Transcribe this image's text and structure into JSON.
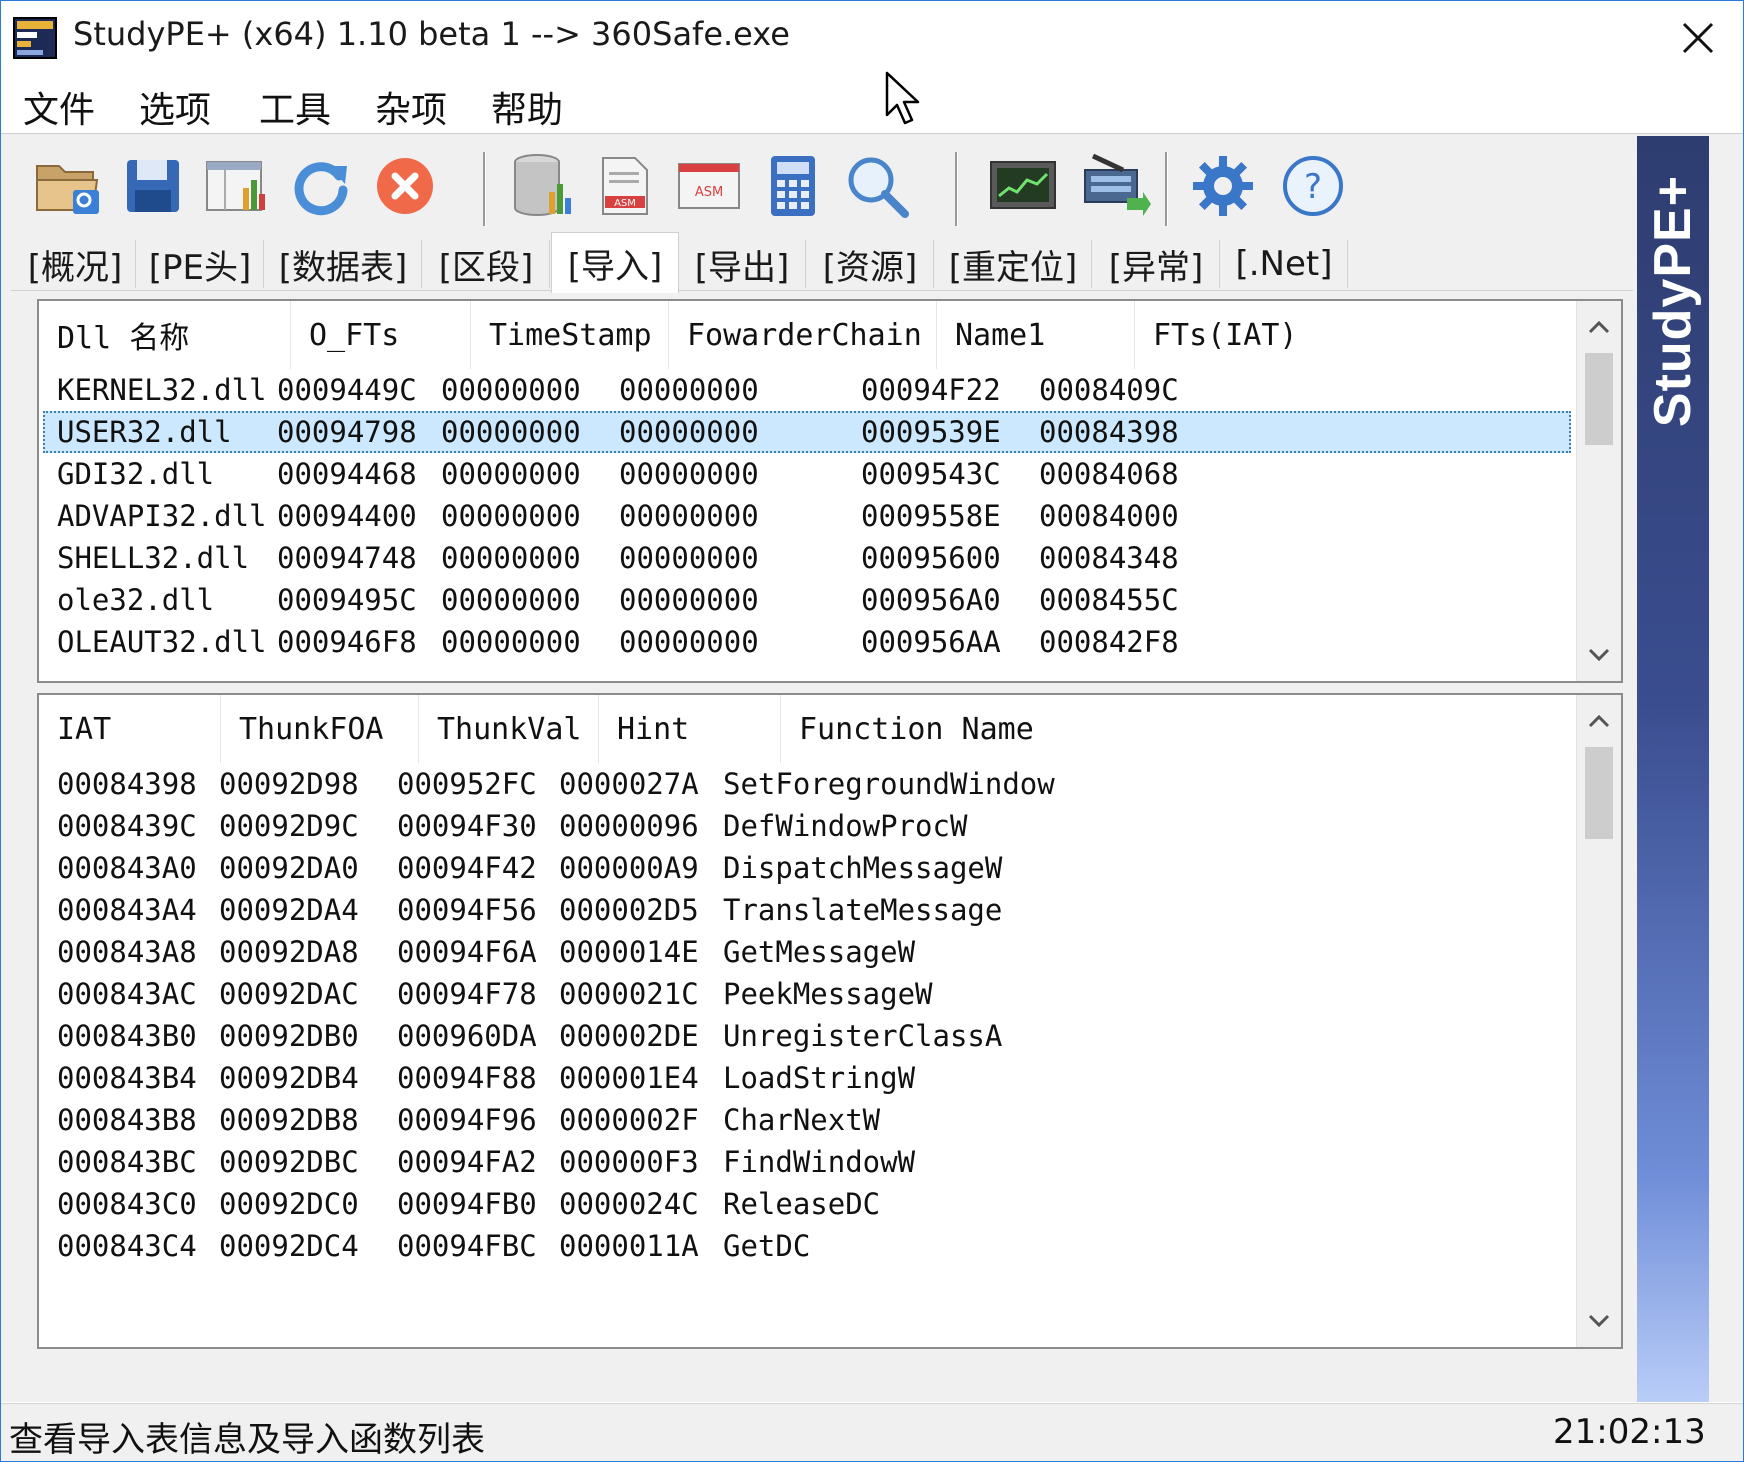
{
  "window": {
    "title": "StudyPE+ (x64) 1.10 beta 1  --> 360Safe.exe"
  },
  "menu": [
    "文件",
    "选项",
    "工具",
    "杂项",
    "帮助"
  ],
  "toolbar": {
    "icons": [
      "open-file-icon",
      "save-icon",
      "pe-view-icon",
      "refresh-icon",
      "close-file-icon",
      "database-icon",
      "asm-file-icon",
      "asm-window-icon",
      "calculator-icon",
      "search-icon",
      "monitor-icon",
      "network-icon",
      "settings-gear-icon",
      "help-icon"
    ]
  },
  "tabs": [
    "[概况]",
    "[PE头]",
    "[数据表]",
    "[区段]",
    "[导入]",
    "[导出]",
    "[资源]",
    "[重定位]",
    "[异常]",
    "[.Net]"
  ],
  "active_tab_index": 4,
  "side_banner": "StudyPE+",
  "dll_table": {
    "columns": [
      "Dll 名称",
      "O_FTs",
      "TimeStamp",
      "FowarderChain",
      "Name1",
      "FTs(IAT)"
    ],
    "rows": [
      [
        "KERNEL32.dll",
        "0009449C",
        "00000000",
        "00000000",
        "00094F22",
        "0008409C"
      ],
      [
        "USER32.dll",
        "00094798",
        "00000000",
        "00000000",
        "0009539E",
        "00084398"
      ],
      [
        "GDI32.dll",
        "00094468",
        "00000000",
        "00000000",
        "0009543C",
        "00084068"
      ],
      [
        "ADVAPI32.dll",
        "00094400",
        "00000000",
        "00000000",
        "0009558E",
        "00084000"
      ],
      [
        "SHELL32.dll",
        "00094748",
        "00000000",
        "00000000",
        "00095600",
        "00084348"
      ],
      [
        "ole32.dll",
        "0009495C",
        "00000000",
        "00000000",
        "000956A0",
        "0008455C"
      ],
      [
        "OLEAUT32.dll",
        "000946F8",
        "00000000",
        "00000000",
        "000956AA",
        "000842F8"
      ]
    ],
    "selected_row": 1
  },
  "func_table": {
    "columns": [
      "IAT",
      "ThunkFOA",
      "ThunkVal",
      "Hint",
      "Function Name"
    ],
    "rows": [
      [
        "00084398",
        "00092D98",
        "000952FC",
        "0000027A",
        "SetForegroundWindow"
      ],
      [
        "0008439C",
        "00092D9C",
        "00094F30",
        "00000096",
        "DefWindowProcW"
      ],
      [
        "000843A0",
        "00092DA0",
        "00094F42",
        "000000A9",
        "DispatchMessageW"
      ],
      [
        "000843A4",
        "00092DA4",
        "00094F56",
        "000002D5",
        "TranslateMessage"
      ],
      [
        "000843A8",
        "00092DA8",
        "00094F6A",
        "0000014E",
        "GetMessageW"
      ],
      [
        "000843AC",
        "00092DAC",
        "00094F78",
        "0000021C",
        "PeekMessageW"
      ],
      [
        "000843B0",
        "00092DB0",
        "000960DA",
        "000002DE",
        "UnregisterClassA"
      ],
      [
        "000843B4",
        "00092DB4",
        "00094F88",
        "000001E4",
        "LoadStringW"
      ],
      [
        "000843B8",
        "00092DB8",
        "00094F96",
        "0000002F",
        "CharNextW"
      ],
      [
        "000843BC",
        "00092DBC",
        "00094FA2",
        "000000F3",
        "FindWindowW"
      ],
      [
        "000843C0",
        "00092DC0",
        "00094FB0",
        "0000024C",
        "ReleaseDC"
      ],
      [
        "000843C4",
        "00092DC4",
        "00094FBC",
        "0000011A",
        "GetDC"
      ]
    ]
  },
  "status": {
    "text": "查看导入表信息及导入函数列表",
    "time": "21:02:13"
  }
}
